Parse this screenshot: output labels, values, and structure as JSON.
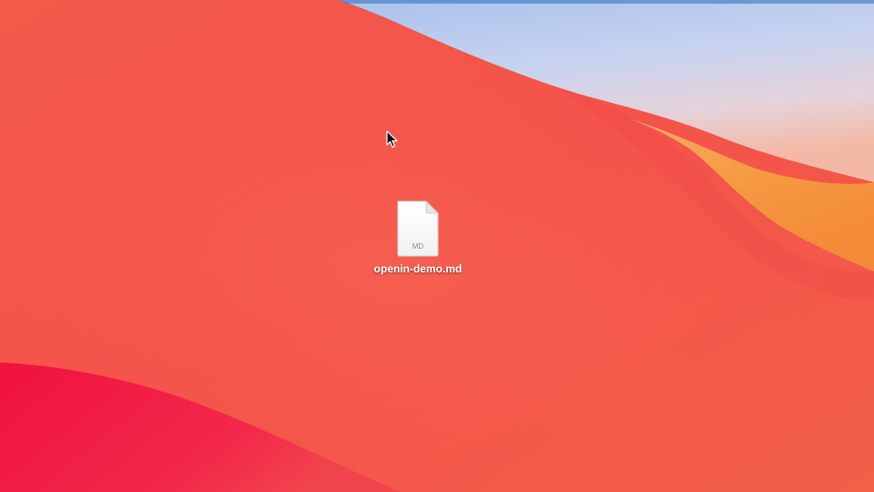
{
  "desktop": {
    "colors": {
      "base_red": "#f4524a",
      "deep_red": "#f0143c",
      "sky_top": "#a9c4ee",
      "sky_mid": "#d4dcef",
      "sky_band": "#f3c0b3",
      "orange": "#f5943c"
    }
  },
  "file": {
    "name": "openin-demo.md",
    "badge": "MD",
    "icon": "markdown-document-icon"
  },
  "cursor": {
    "icon": "arrow-pointer-icon"
  }
}
